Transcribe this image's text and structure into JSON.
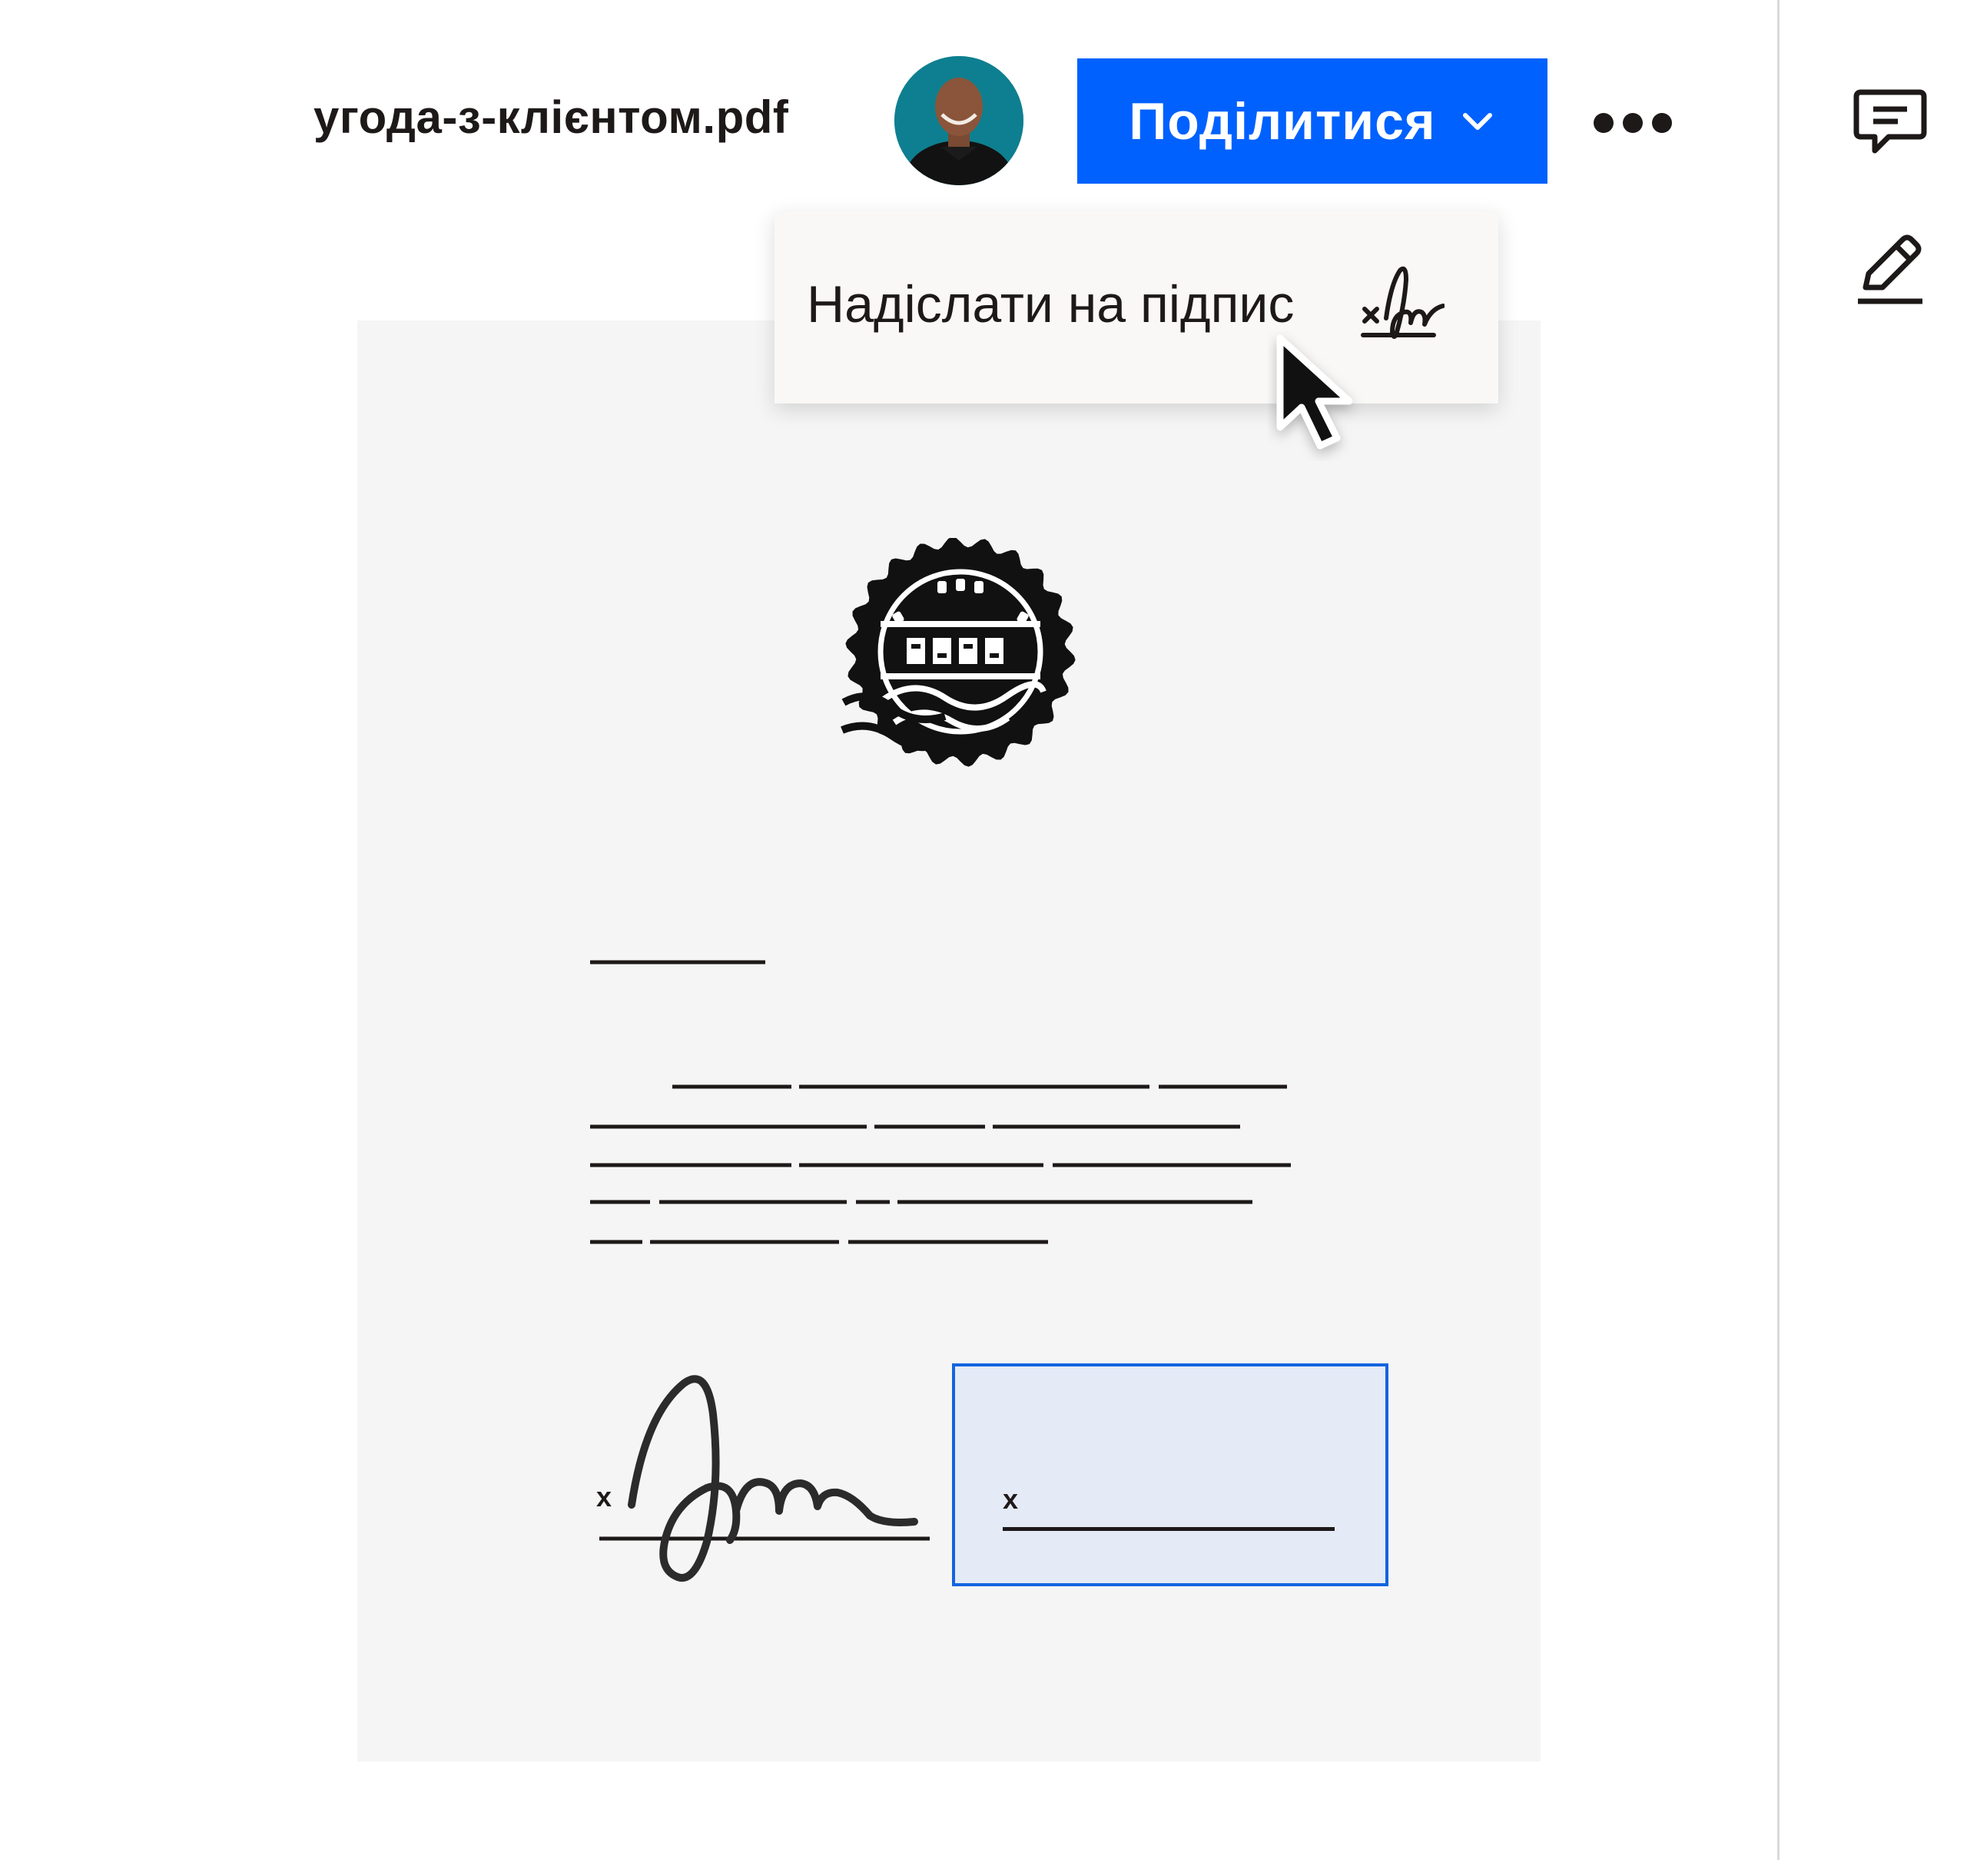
{
  "header": {
    "file_name": "угода-з-клієнтом.pdf",
    "share_label": "Поділитися"
  },
  "share_menu": {
    "items": [
      {
        "label": "Надіслати на підпис",
        "icon": "signature-icon"
      }
    ]
  },
  "sidebar": {
    "icons": [
      "comment-icon",
      "pencil-icon"
    ]
  },
  "document": {
    "signatures": [
      {
        "mark": "x",
        "status": "signed"
      },
      {
        "mark": "x",
        "status": "pending"
      }
    ]
  },
  "colors": {
    "accent": "#0061fe",
    "signature_field_bg": "#e4eaf6",
    "signature_field_border": "#1364e0"
  }
}
